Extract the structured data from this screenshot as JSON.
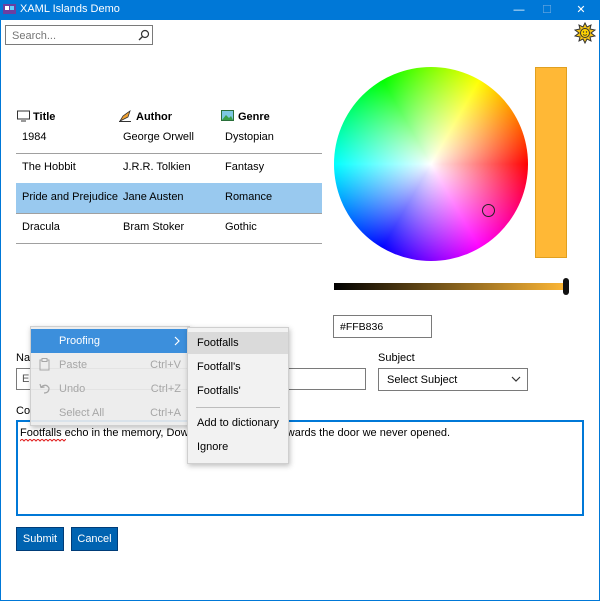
{
  "window": {
    "title": "XAML Islands Demo",
    "minimize": "—",
    "maximize": "☐",
    "close": "✕"
  },
  "search": {
    "placeholder": "Search..."
  },
  "table": {
    "headers": [
      "Title",
      "Author",
      "Genre"
    ],
    "rows": [
      [
        "1984",
        "George Orwell",
        "Dystopian"
      ],
      [
        "The Hobbit",
        "J.R.R. Tolkien",
        "Fantasy"
      ],
      [
        "Pride and Prejudice",
        "Jane Austen",
        "Romance"
      ],
      [
        "Dracula",
        "Bram Stoker",
        "Gothic"
      ]
    ],
    "selected_row": 2
  },
  "color_picker": {
    "hex": "#FFB836",
    "selected_color": "#ffb836",
    "brightness_percent": 100
  },
  "form": {
    "name_label": "Na",
    "name_value": "E",
    "subject_label": "Subject",
    "subject_value": "Select Subject",
    "comment_label": "Co",
    "comment_text": "Footfalls echo in the memory, Down  ve did not take, Towards the door we never opened.",
    "submit_label": "Submit",
    "cancel_label": "Cancel"
  },
  "context_menu": {
    "items": [
      {
        "label": "Proofing",
        "shortcut": "",
        "icon": "",
        "enabled": true
      },
      {
        "label": "Paste",
        "shortcut": "Ctrl+V",
        "icon": "paste-icon",
        "enabled": false
      },
      {
        "label": "Undo",
        "shortcut": "Ctrl+Z",
        "icon": "undo-icon",
        "enabled": false
      },
      {
        "label": "Select All",
        "shortcut": "Ctrl+A",
        "icon": "",
        "enabled": false
      }
    ],
    "submenu": [
      "Footfalls",
      "Footfall's",
      "Footfalls'",
      "Add to dictionary",
      "Ignore"
    ]
  },
  "colors": {
    "accent": "#0078d7",
    "button": "#0063b1",
    "selected_row": "#99c9ef",
    "menu_highlight": "#3c8fdc"
  }
}
